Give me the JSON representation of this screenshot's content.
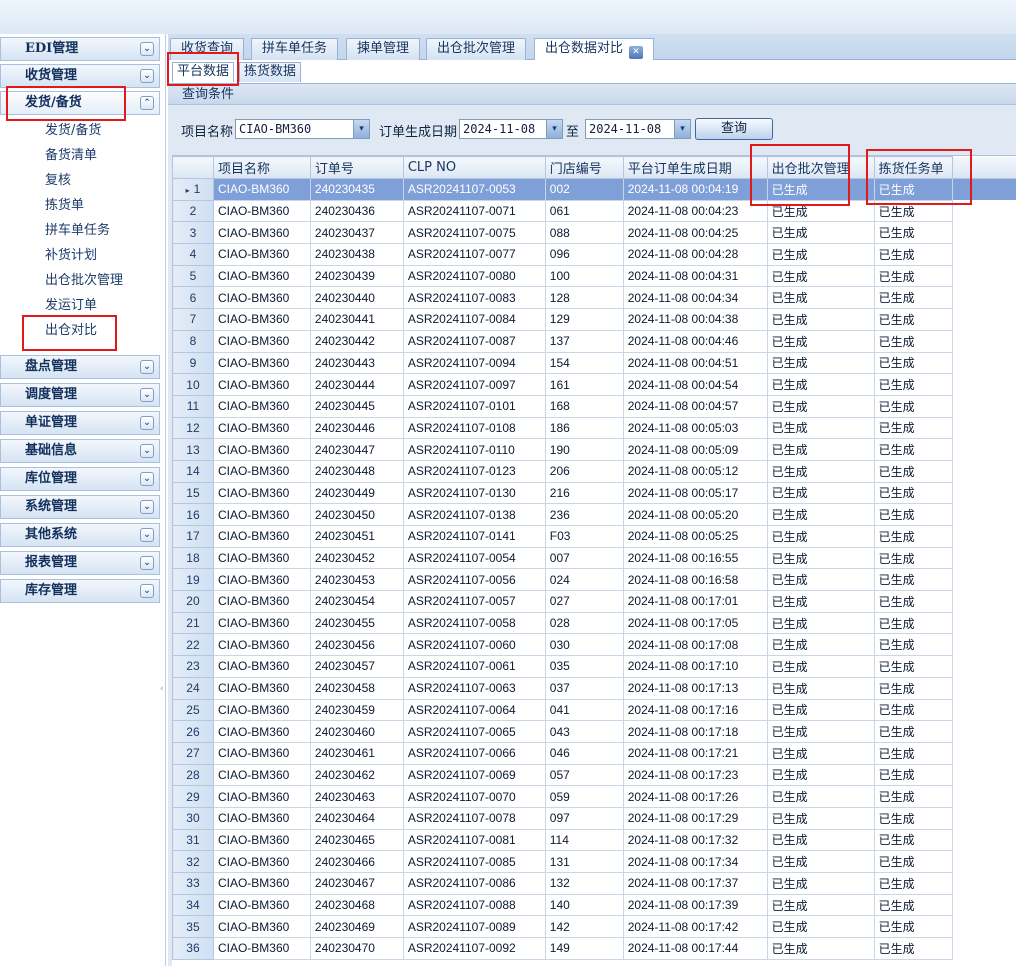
{
  "sidebar": {
    "groups": [
      {
        "label": "EDI管理",
        "chevron": "⌄"
      },
      {
        "label": "收货管理",
        "chevron": "⌄"
      },
      {
        "label": "发货/备货",
        "chevron": "⌃"
      },
      {
        "label": "盘点管理",
        "chevron": "⌄"
      },
      {
        "label": "调度管理",
        "chevron": "⌄"
      },
      {
        "label": "单证管理",
        "chevron": "⌄"
      },
      {
        "label": "基础信息",
        "chevron": "⌄"
      },
      {
        "label": "库位管理",
        "chevron": "⌄"
      },
      {
        "label": "系统管理",
        "chevron": "⌄"
      },
      {
        "label": "其他系统",
        "chevron": "⌄"
      },
      {
        "label": "报表管理",
        "chevron": "⌄"
      },
      {
        "label": "库存管理",
        "chevron": "⌄"
      }
    ],
    "sub_items": [
      "发货/备货",
      "备货清单",
      "复核",
      "拣货单",
      "拼车单任务",
      "补货计划",
      "出仓批次管理",
      "发运订单",
      "出仓对比"
    ],
    "collapse_glyph": "‹"
  },
  "tabs": [
    "收货查询",
    "拼车单任务",
    "揀单管理",
    "出仓批次管理",
    "出仓数据对比"
  ],
  "close_glyph": "✕",
  "subtabs": [
    "平台数据",
    "拣货数据"
  ],
  "query": {
    "header": "查询条件",
    "project_label": "项目名称",
    "project_value": "CIAO-BM360",
    "date_label": "订单生成日期",
    "date_from": "2024-11-08",
    "to_label": "至",
    "date_to": "2024-11-08",
    "button": "查询",
    "dropdown_glyph": "▾"
  },
  "grid": {
    "columns": [
      "",
      "项目名称",
      "订单号",
      "CLP NO",
      "门店编号",
      "平台订单生成日期",
      "出仓批次管理",
      "拣货任务单"
    ],
    "selected_marker": "▸",
    "rows": [
      [
        "1",
        "CIAO-BM360",
        "240230435",
        "ASR20241107-0053",
        "002",
        "2024-11-08 00:04:19",
        "已生成",
        "已生成"
      ],
      [
        "2",
        "CIAO-BM360",
        "240230436",
        "ASR20241107-0071",
        "061",
        "2024-11-08 00:04:23",
        "已生成",
        "已生成"
      ],
      [
        "3",
        "CIAO-BM360",
        "240230437",
        "ASR20241107-0075",
        "088",
        "2024-11-08 00:04:25",
        "已生成",
        "已生成"
      ],
      [
        "4",
        "CIAO-BM360",
        "240230438",
        "ASR20241107-0077",
        "096",
        "2024-11-08 00:04:28",
        "已生成",
        "已生成"
      ],
      [
        "5",
        "CIAO-BM360",
        "240230439",
        "ASR20241107-0080",
        "100",
        "2024-11-08 00:04:31",
        "已生成",
        "已生成"
      ],
      [
        "6",
        "CIAO-BM360",
        "240230440",
        "ASR20241107-0083",
        "128",
        "2024-11-08 00:04:34",
        "已生成",
        "已生成"
      ],
      [
        "7",
        "CIAO-BM360",
        "240230441",
        "ASR20241107-0084",
        "129",
        "2024-11-08 00:04:38",
        "已生成",
        "已生成"
      ],
      [
        "8",
        "CIAO-BM360",
        "240230442",
        "ASR20241107-0087",
        "137",
        "2024-11-08 00:04:46",
        "已生成",
        "已生成"
      ],
      [
        "9",
        "CIAO-BM360",
        "240230443",
        "ASR20241107-0094",
        "154",
        "2024-11-08 00:04:51",
        "已生成",
        "已生成"
      ],
      [
        "10",
        "CIAO-BM360",
        "240230444",
        "ASR20241107-0097",
        "161",
        "2024-11-08 00:04:54",
        "已生成",
        "已生成"
      ],
      [
        "11",
        "CIAO-BM360",
        "240230445",
        "ASR20241107-0101",
        "168",
        "2024-11-08 00:04:57",
        "已生成",
        "已生成"
      ],
      [
        "12",
        "CIAO-BM360",
        "240230446",
        "ASR20241107-0108",
        "186",
        "2024-11-08 00:05:03",
        "已生成",
        "已生成"
      ],
      [
        "13",
        "CIAO-BM360",
        "240230447",
        "ASR20241107-0110",
        "190",
        "2024-11-08 00:05:09",
        "已生成",
        "已生成"
      ],
      [
        "14",
        "CIAO-BM360",
        "240230448",
        "ASR20241107-0123",
        "206",
        "2024-11-08 00:05:12",
        "已生成",
        "已生成"
      ],
      [
        "15",
        "CIAO-BM360",
        "240230449",
        "ASR20241107-0130",
        "216",
        "2024-11-08 00:05:17",
        "已生成",
        "已生成"
      ],
      [
        "16",
        "CIAO-BM360",
        "240230450",
        "ASR20241107-0138",
        "236",
        "2024-11-08 00:05:20",
        "已生成",
        "已生成"
      ],
      [
        "17",
        "CIAO-BM360",
        "240230451",
        "ASR20241107-0141",
        "F03",
        "2024-11-08 00:05:25",
        "已生成",
        "已生成"
      ],
      [
        "18",
        "CIAO-BM360",
        "240230452",
        "ASR20241107-0054",
        "007",
        "2024-11-08 00:16:55",
        "已生成",
        "已生成"
      ],
      [
        "19",
        "CIAO-BM360",
        "240230453",
        "ASR20241107-0056",
        "024",
        "2024-11-08 00:16:58",
        "已生成",
        "已生成"
      ],
      [
        "20",
        "CIAO-BM360",
        "240230454",
        "ASR20241107-0057",
        "027",
        "2024-11-08 00:17:01",
        "已生成",
        "已生成"
      ],
      [
        "21",
        "CIAO-BM360",
        "240230455",
        "ASR20241107-0058",
        "028",
        "2024-11-08 00:17:05",
        "已生成",
        "已生成"
      ],
      [
        "22",
        "CIAO-BM360",
        "240230456",
        "ASR20241107-0060",
        "030",
        "2024-11-08 00:17:08",
        "已生成",
        "已生成"
      ],
      [
        "23",
        "CIAO-BM360",
        "240230457",
        "ASR20241107-0061",
        "035",
        "2024-11-08 00:17:10",
        "已生成",
        "已生成"
      ],
      [
        "24",
        "CIAO-BM360",
        "240230458",
        "ASR20241107-0063",
        "037",
        "2024-11-08 00:17:13",
        "已生成",
        "已生成"
      ],
      [
        "25",
        "CIAO-BM360",
        "240230459",
        "ASR20241107-0064",
        "041",
        "2024-11-08 00:17:16",
        "已生成",
        "已生成"
      ],
      [
        "26",
        "CIAO-BM360",
        "240230460",
        "ASR20241107-0065",
        "043",
        "2024-11-08 00:17:18",
        "已生成",
        "已生成"
      ],
      [
        "27",
        "CIAO-BM360",
        "240230461",
        "ASR20241107-0066",
        "046",
        "2024-11-08 00:17:21",
        "已生成",
        "已生成"
      ],
      [
        "28",
        "CIAO-BM360",
        "240230462",
        "ASR20241107-0069",
        "057",
        "2024-11-08 00:17:23",
        "已生成",
        "已生成"
      ],
      [
        "29",
        "CIAO-BM360",
        "240230463",
        "ASR20241107-0070",
        "059",
        "2024-11-08 00:17:26",
        "已生成",
        "已生成"
      ],
      [
        "30",
        "CIAO-BM360",
        "240230464",
        "ASR20241107-0078",
        "097",
        "2024-11-08 00:17:29",
        "已生成",
        "已生成"
      ],
      [
        "31",
        "CIAO-BM360",
        "240230465",
        "ASR20241107-0081",
        "114",
        "2024-11-08 00:17:32",
        "已生成",
        "已生成"
      ],
      [
        "32",
        "CIAO-BM360",
        "240230466",
        "ASR20241107-0085",
        "131",
        "2024-11-08 00:17:34",
        "已生成",
        "已生成"
      ],
      [
        "33",
        "CIAO-BM360",
        "240230467",
        "ASR20241107-0086",
        "132",
        "2024-11-08 00:17:37",
        "已生成",
        "已生成"
      ],
      [
        "34",
        "CIAO-BM360",
        "240230468",
        "ASR20241107-0088",
        "140",
        "2024-11-08 00:17:39",
        "已生成",
        "已生成"
      ],
      [
        "35",
        "CIAO-BM360",
        "240230469",
        "ASR20241107-0089",
        "142",
        "2024-11-08 00:17:42",
        "已生成",
        "已生成"
      ],
      [
        "36",
        "CIAO-BM360",
        "240230470",
        "ASR20241107-0092",
        "149",
        "2024-11-08 00:17:44",
        "已生成",
        "已生成"
      ]
    ]
  },
  "colors": {
    "highlight": "#e0191b",
    "selected_row": "#7f9fd9"
  }
}
